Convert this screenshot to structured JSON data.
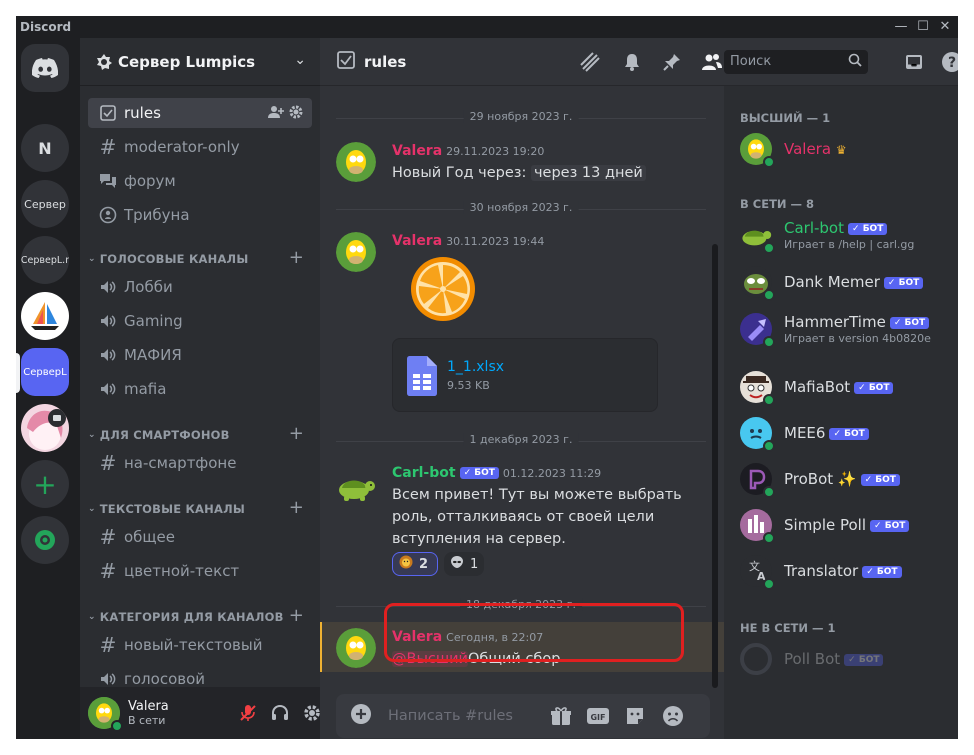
{
  "app": {
    "name": "Discord"
  },
  "rail": {
    "servers": [
      {
        "label": "N"
      },
      {
        "label": "Сервер"
      },
      {
        "label": "СерверL.r"
      },
      {
        "label": "СерверL"
      }
    ]
  },
  "guild": {
    "name": "Сервер Lumpics"
  },
  "channels": {
    "items": [
      {
        "label": "rules"
      },
      {
        "label": "moderator-only"
      },
      {
        "label": "форум"
      },
      {
        "label": "Трибуна"
      }
    ],
    "voice_category": "ГОЛОСОВЫЕ КАНАЛЫ",
    "voice": [
      {
        "label": "Лобби"
      },
      {
        "label": "Gaming"
      },
      {
        "label": "МАФИЯ"
      },
      {
        "label": "mafia"
      }
    ],
    "phone_category": "ДЛЯ СМАРТФОНОВ",
    "phone": [
      {
        "label": "на-смартфоне"
      }
    ],
    "text_category": "ТЕКСТОВЫЕ КАНАЛЫ",
    "text": [
      {
        "label": "общее"
      },
      {
        "label": "цветной-текст"
      }
    ],
    "cat_category": "КАТЕГОРИЯ ДЛЯ КАНАЛОВ",
    "cat": [
      {
        "label": "новый-текстовый"
      },
      {
        "label": "голосовой"
      }
    ]
  },
  "user": {
    "name": "Valera",
    "status": "В сети"
  },
  "chat": {
    "channel": "rules",
    "search_placeholder": "Поиск",
    "composer_placeholder": "Написать #rules",
    "dividers": [
      "29 ноября 2023 г.",
      "30 ноября 2023 г.",
      "1 декабря 2023 г.",
      "18 декабря 2023 г."
    ],
    "messages": [
      {
        "author": "Valera",
        "time": "29.11.2023 19:20",
        "text": "Новый Год через:",
        "timestamp_chip": "через 13 дней"
      },
      {
        "author": "Valera",
        "time": "30.11.2023 19:44",
        "attachment": {
          "name": "1_1.xlsx",
          "size": "9.53 KB"
        }
      },
      {
        "author": "Carl-bot",
        "bot": "БОТ",
        "time": "01.12.2023 11:29",
        "lines": [
          "Всем привет! Тут вы можете выбрать",
          "роль, отталкиваясь от своей цели",
          "вступления на сервер."
        ],
        "reactions": [
          {
            "count": "2"
          },
          {
            "count": "1"
          }
        ]
      },
      {
        "author": "Valera",
        "time": "Сегодня, в 22:07",
        "mention": "@Высший",
        "text": "Общий сбор"
      }
    ]
  },
  "members": {
    "role_cat": "ВЫСШИЙ — 1",
    "online_cat": "В СЕТИ — 8",
    "offline_cat": "НЕ В СЕТИ — 1",
    "bot_tag": "БОТ",
    "list": [
      {
        "name": "Valera"
      },
      {
        "name": "Carl-bot",
        "sub": "Играет в /help | carl.gg"
      },
      {
        "name": "Dank Memer"
      },
      {
        "name": "HammerTime",
        "sub": "Играет в version 4b0820e"
      },
      {
        "name": "MafiaBot"
      },
      {
        "name": "MEE6"
      },
      {
        "name": "ProBot ✨"
      },
      {
        "name": "Simple Poll"
      },
      {
        "name": "Translator"
      },
      {
        "name": "Poll Bot"
      }
    ]
  },
  "colors": {
    "brand": "#5865f2",
    "online": "#23a55a",
    "valera": "#e5326a",
    "carlbot": "#2dc770",
    "highlight": "#e02020"
  }
}
